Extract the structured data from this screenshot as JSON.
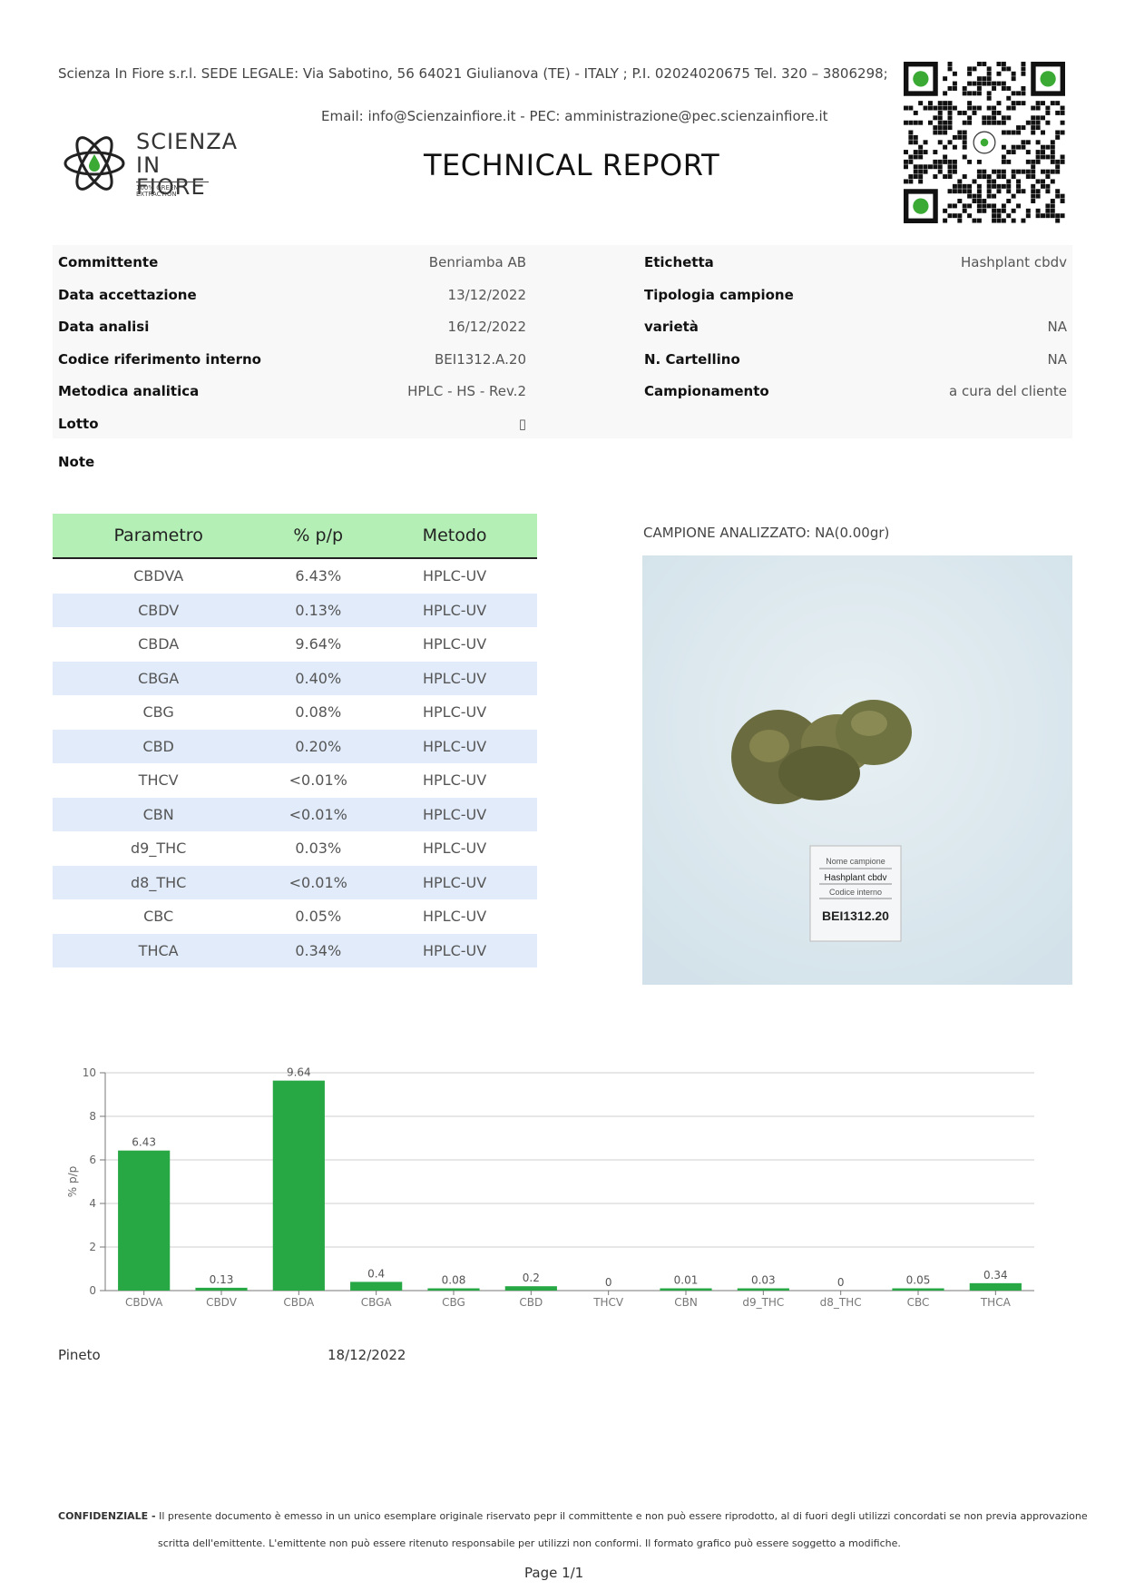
{
  "header": {
    "company_line": "Scienza In Fiore s.r.l. SEDE LEGALE: Via Sabotino, 56 64021 Giulianova (TE) - ITALY ; P.I. 02024020675 Tel. 320 – 3806298;",
    "email_line": "Email: info@Scienzainfiore.it - PEC: amministrazione@pec.scienzainfiore.it",
    "title": "TECHNICAL REPORT",
    "logo_line1": "SCIENZA",
    "logo_line2": "IN FIORE",
    "logo_tagline": "100% GREEN EXTRACTION"
  },
  "info": {
    "left": [
      {
        "label": "Committente",
        "value": "Benriamba AB"
      },
      {
        "label": "Data accettazione",
        "value": "13/12/2022"
      },
      {
        "label": "Data analisi",
        "value": "16/12/2022"
      },
      {
        "label": "Codice riferimento interno",
        "value": "BEI1312.A.20"
      },
      {
        "label": "Metodica analitica",
        "value": "HPLC - HS - Rev.2"
      },
      {
        "label": "Lotto",
        "value": "▯"
      }
    ],
    "right": [
      {
        "label": "Etichetta",
        "value": "Hashplant cbdv"
      },
      {
        "label": "Tipologia campione",
        "value": ""
      },
      {
        "label": "varietà",
        "value": "NA"
      },
      {
        "label": "N. Cartellino",
        "value": "NA"
      },
      {
        "label": "Campionamento",
        "value": "a cura del cliente"
      }
    ],
    "note_label": "Note"
  },
  "table": {
    "headers": [
      "Parametro",
      "% p/p",
      "Metodo"
    ],
    "rows": [
      [
        "CBDVA",
        "6.43%",
        "HPLC-UV"
      ],
      [
        "CBDV",
        "0.13%",
        "HPLC-UV"
      ],
      [
        "CBDA",
        "9.64%",
        "HPLC-UV"
      ],
      [
        "CBGA",
        "0.40%",
        "HPLC-UV"
      ],
      [
        "CBG",
        "0.08%",
        "HPLC-UV"
      ],
      [
        "CBD",
        "0.20%",
        "HPLC-UV"
      ],
      [
        "THCV",
        "<0.01%",
        "HPLC-UV"
      ],
      [
        "CBN",
        "<0.01%",
        "HPLC-UV"
      ],
      [
        "d9_THC",
        "0.03%",
        "HPLC-UV"
      ],
      [
        "d8_THC",
        "<0.01%",
        "HPLC-UV"
      ],
      [
        "CBC",
        "0.05%",
        "HPLC-UV"
      ],
      [
        "THCA",
        "0.34%",
        "HPLC-UV"
      ]
    ]
  },
  "sample": {
    "caption": "CAMPIONE ANALIZZATO: NA(0.00gr)",
    "card_line1": "Nome campione",
    "card_line2": "Hashplant cbdv",
    "card_line3": "Codice interno",
    "card_line4": "BEI1312.20"
  },
  "chart_data": {
    "type": "bar",
    "categories": [
      "CBDVA",
      "CBDV",
      "CBDA",
      "CBGA",
      "CBG",
      "CBD",
      "THCV",
      "CBN",
      "d9_THC",
      "d8_THC",
      "CBC",
      "THCA"
    ],
    "values": [
      6.43,
      0.13,
      9.64,
      0.4,
      0.08,
      0.2,
      0,
      0.01,
      0.03,
      0,
      0.05,
      0.34
    ],
    "data_labels": [
      "6.43",
      "0.13",
      "9.64",
      "0.4",
      "0.08",
      "0.2",
      "0",
      "0.01",
      "0.03",
      "0",
      "0.05",
      "0.34"
    ],
    "ylabel": "% p/p",
    "ylim": [
      0,
      10
    ],
    "yticks": [
      0,
      2,
      4,
      6,
      8,
      10
    ],
    "grid": true,
    "bar_color": "#28a745"
  },
  "footer": {
    "place": "Pineto",
    "date": "18/12/2022",
    "confidential_label": "CONFIDENZIALE -",
    "confidential_text": "Il presente documento è emesso in un unico esemplare originale riservato pepr il committente e non può essere riprodotto, al di fuori degli utilizzi concordati se non previa approvazione",
    "confidential_text2": "scritta dell'emittente. L'emittente non può essere ritenuto responsabile per utilizzi non conformi. Il formato grafico può essere soggetto a modifiche.",
    "page": "Page 1/1"
  },
  "colors": {
    "table_header": "#b4efb5",
    "table_alt_row": "#e1ebfa",
    "bar": "#28a745",
    "logo_green": "#3aaa35"
  }
}
